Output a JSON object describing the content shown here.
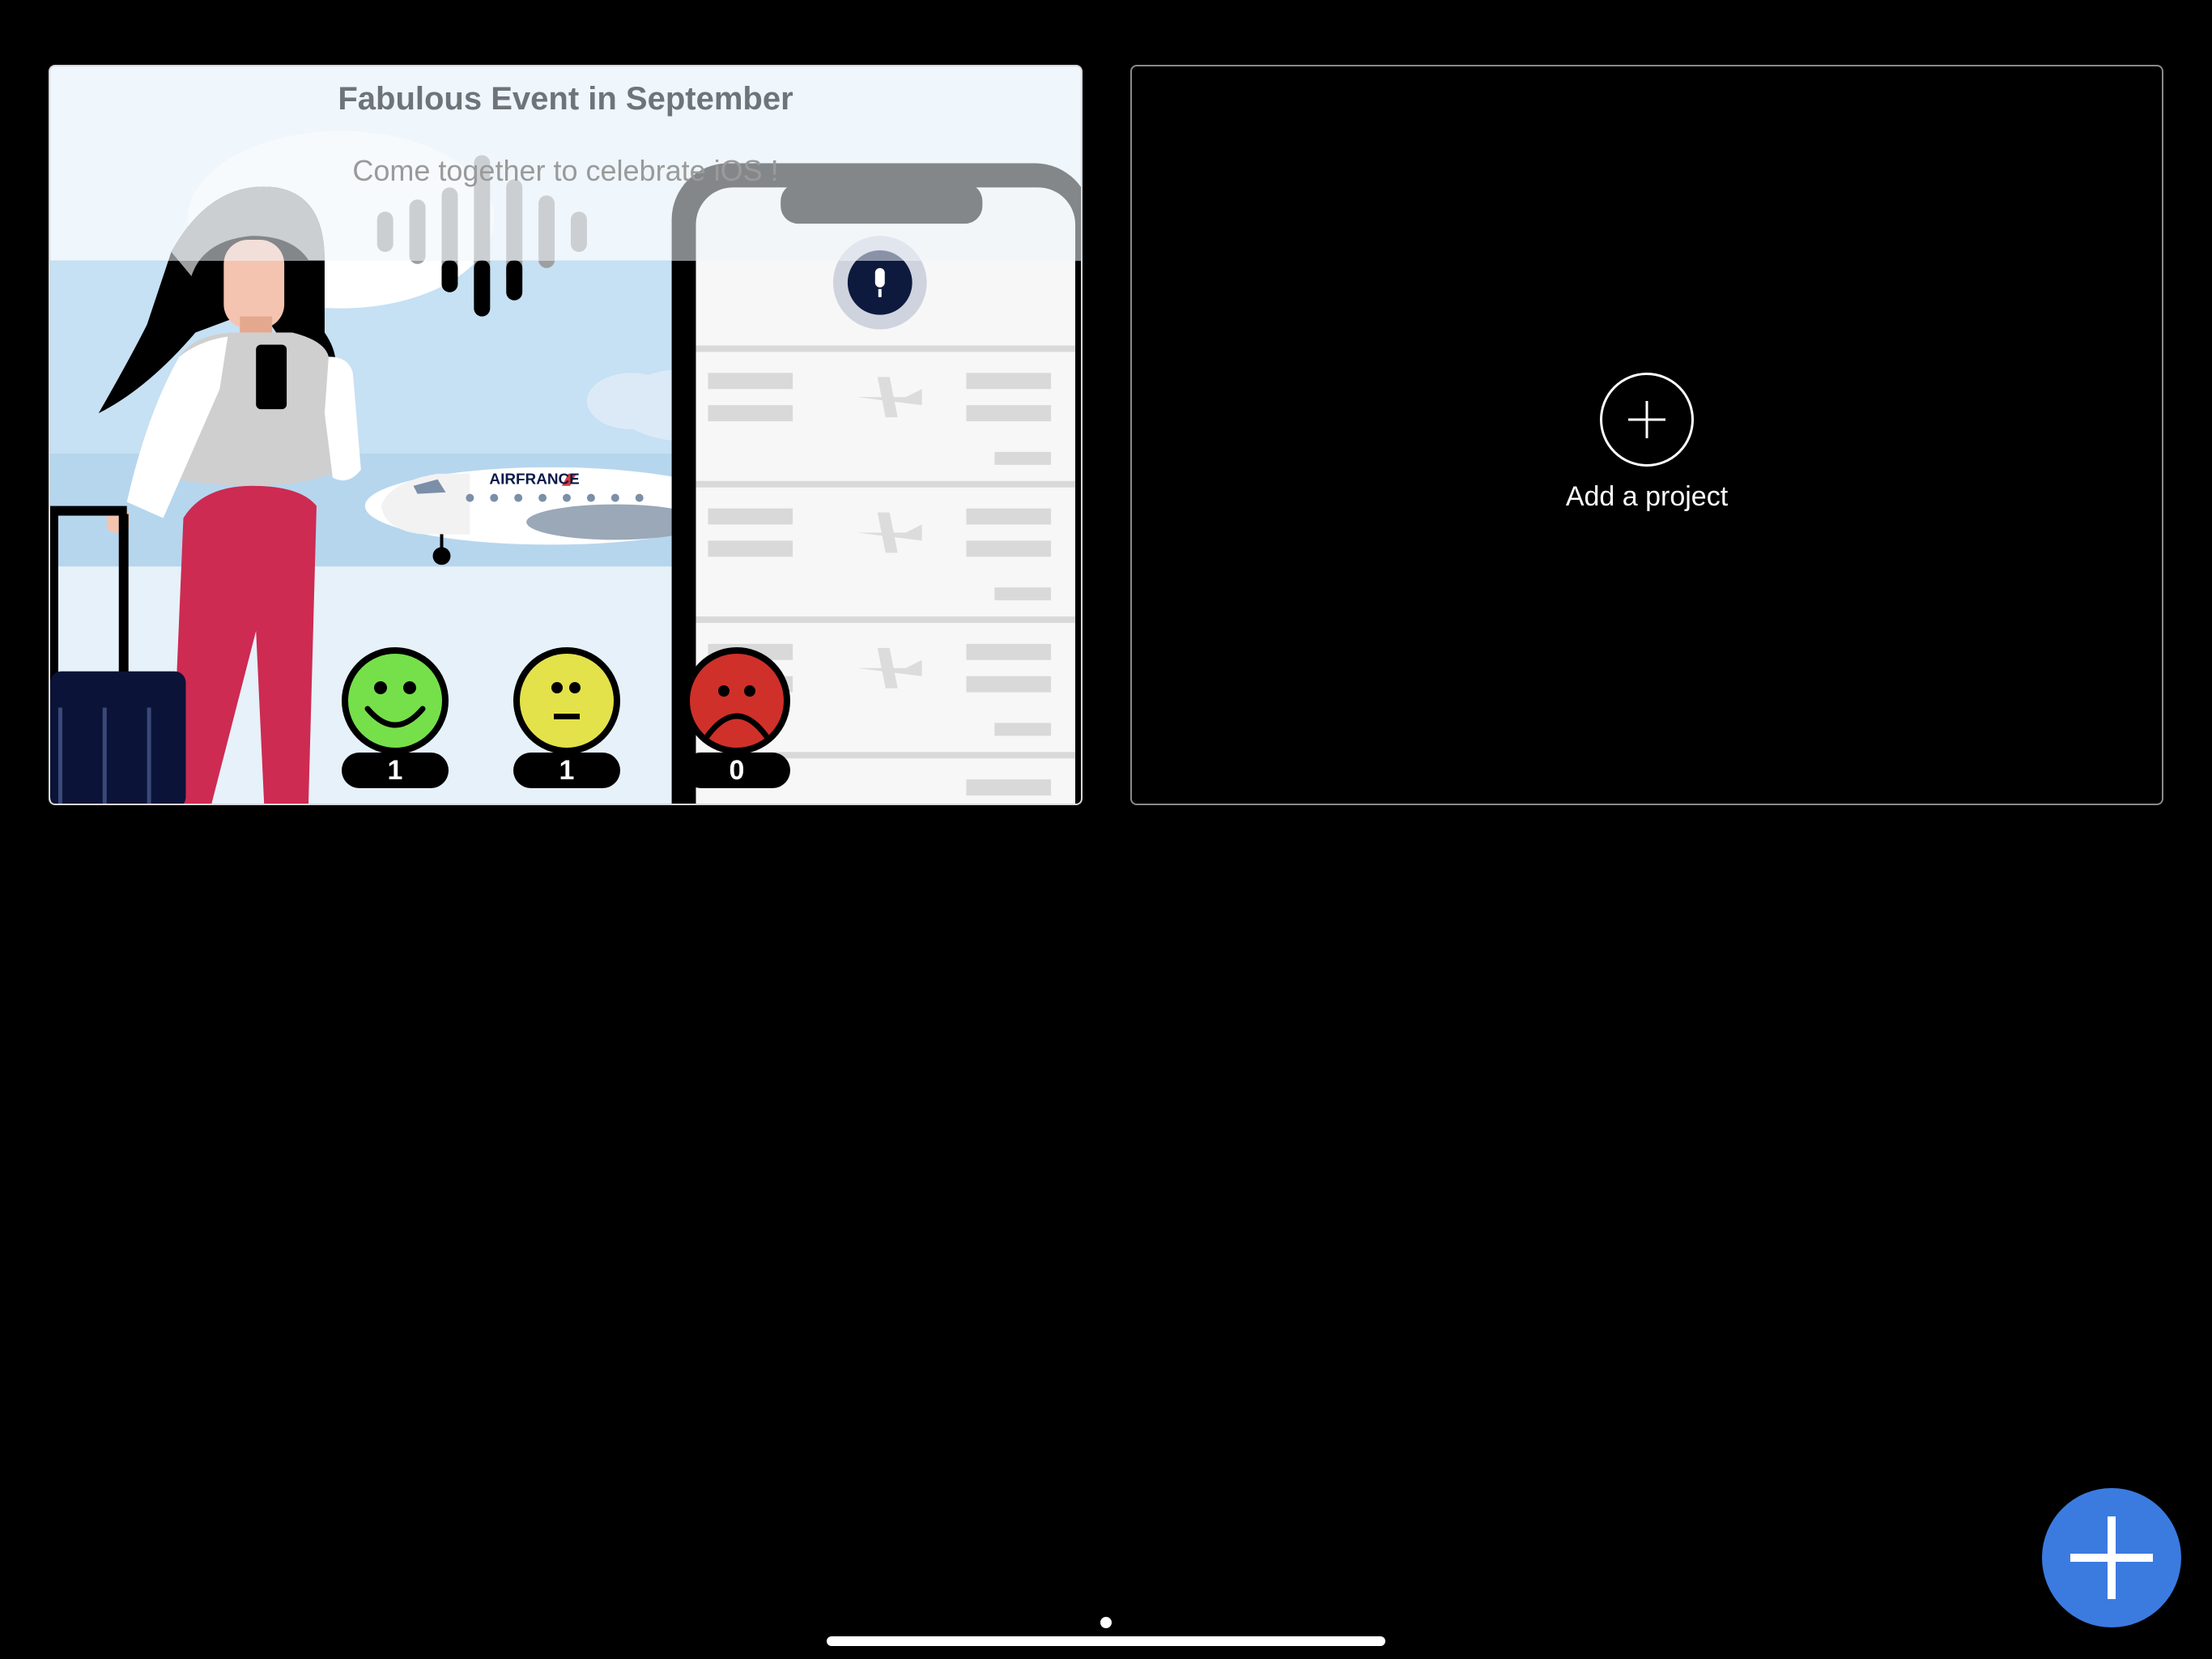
{
  "event_card": {
    "title": "Fabulous Event in September",
    "subtitle": "Come together to celebrate iOS !",
    "airline_label": "AIRFRANCE",
    "votes": [
      {
        "mood": "happy",
        "count": "1",
        "color": "#76e04a"
      },
      {
        "mood": "neutral",
        "count": "1",
        "color": "#e3e24a"
      },
      {
        "mood": "sad",
        "count": "0",
        "color": "#d0302a"
      }
    ]
  },
  "add_card": {
    "label": "Add a project",
    "icon": "plus-circle-icon"
  },
  "fab": {
    "icon": "plus-icon",
    "color": "#3b7be0"
  },
  "colors": {
    "background": "#000000",
    "accent": "#3b7be0"
  }
}
